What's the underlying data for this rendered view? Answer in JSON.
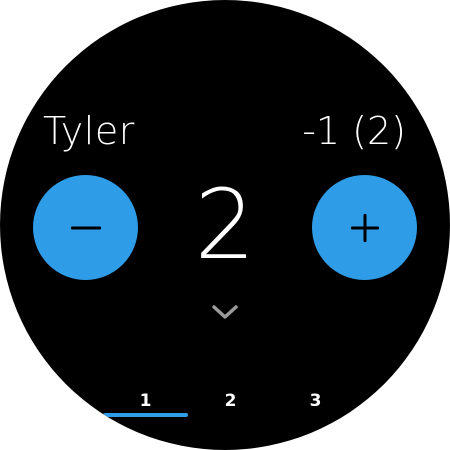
{
  "colors": {
    "background": "#000000",
    "accent": "#2f9ce8",
    "text": "#ffffff",
    "chevron": "#9a9a9a",
    "button_icon": "#000000"
  },
  "player": {
    "name": "Tyler",
    "delta": "-1 (2)",
    "score": "2"
  },
  "controls": {
    "decrement_icon": "minus-icon",
    "increment_icon": "plus-icon",
    "expand_icon": "chevron-down-icon"
  },
  "pages": {
    "tabs": [
      {
        "label": "1",
        "active": true
      },
      {
        "label": "2",
        "active": false
      },
      {
        "label": "3",
        "active": false
      }
    ]
  }
}
